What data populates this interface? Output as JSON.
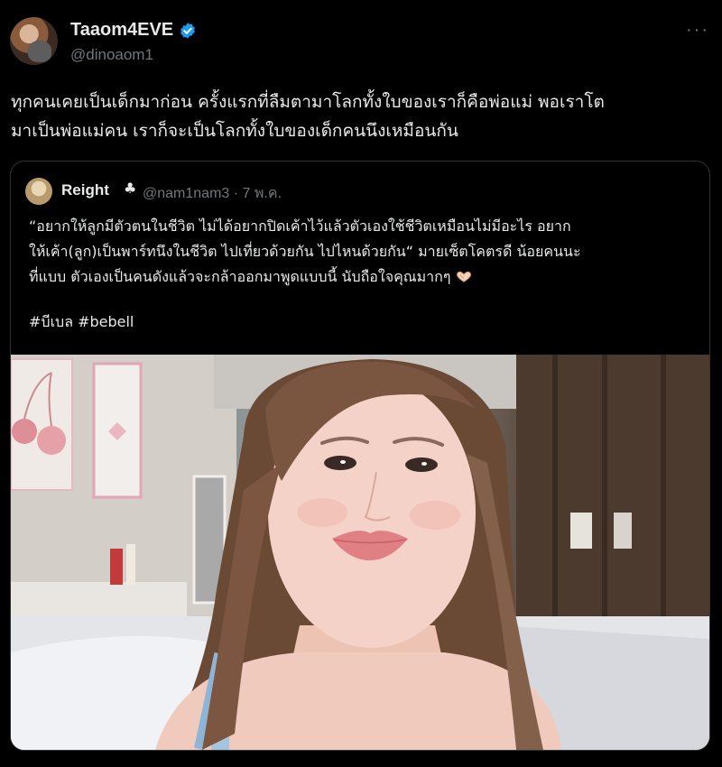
{
  "author": {
    "display_name": "Taaom4EVE",
    "handle": "@dinoaom1",
    "verified": true
  },
  "tweet_lines": [
    "ทุกคนเคยเป็นเด็กมาก่อน ครั้งแรกที่ลืมตามาโลกทั้งใบของเราก็คือพ่อแม่ พอเราโต",
    "มาเป็นพ่อแม่คน เราก็จะเป็นโลกทั้งใบของเด็กคนนึงเหมือนกัน"
  ],
  "more_icon": "···",
  "quoted": {
    "name": "Reight",
    "name_emoji": "♣",
    "handle": "@nam1nam3",
    "dot": "·",
    "time": "7 พ.ค.",
    "text_lines": [
      "“อยากให้ลูกมีตัวตนในชีวิต ไม่ได้อยากปิดเค้าไว้แล้วตัวเองใช้ชีวิตเหมือนไม่มีอะไร อยาก",
      "ให้เค้า(ลูก)เป็นพาร์ทนึงในชีวิต ไปเที่ยวด้วยกัน ไปไหนด้วยกัน“ มายเซ็ตโคตรดี น้อยคนนะ",
      "ที่แบบ ตัวเองเป็นคนดังแล้วจะกล้าออกมาพูดแบบนี้ นับถือใจคุณมากๆ"
    ],
    "hashtags": "#บีเบล #bebell"
  },
  "colors": {
    "background": "#000000",
    "text": "#e7e9ea",
    "muted": "#71767b",
    "border": "#2f3336",
    "verified": "#1d9bf0"
  }
}
